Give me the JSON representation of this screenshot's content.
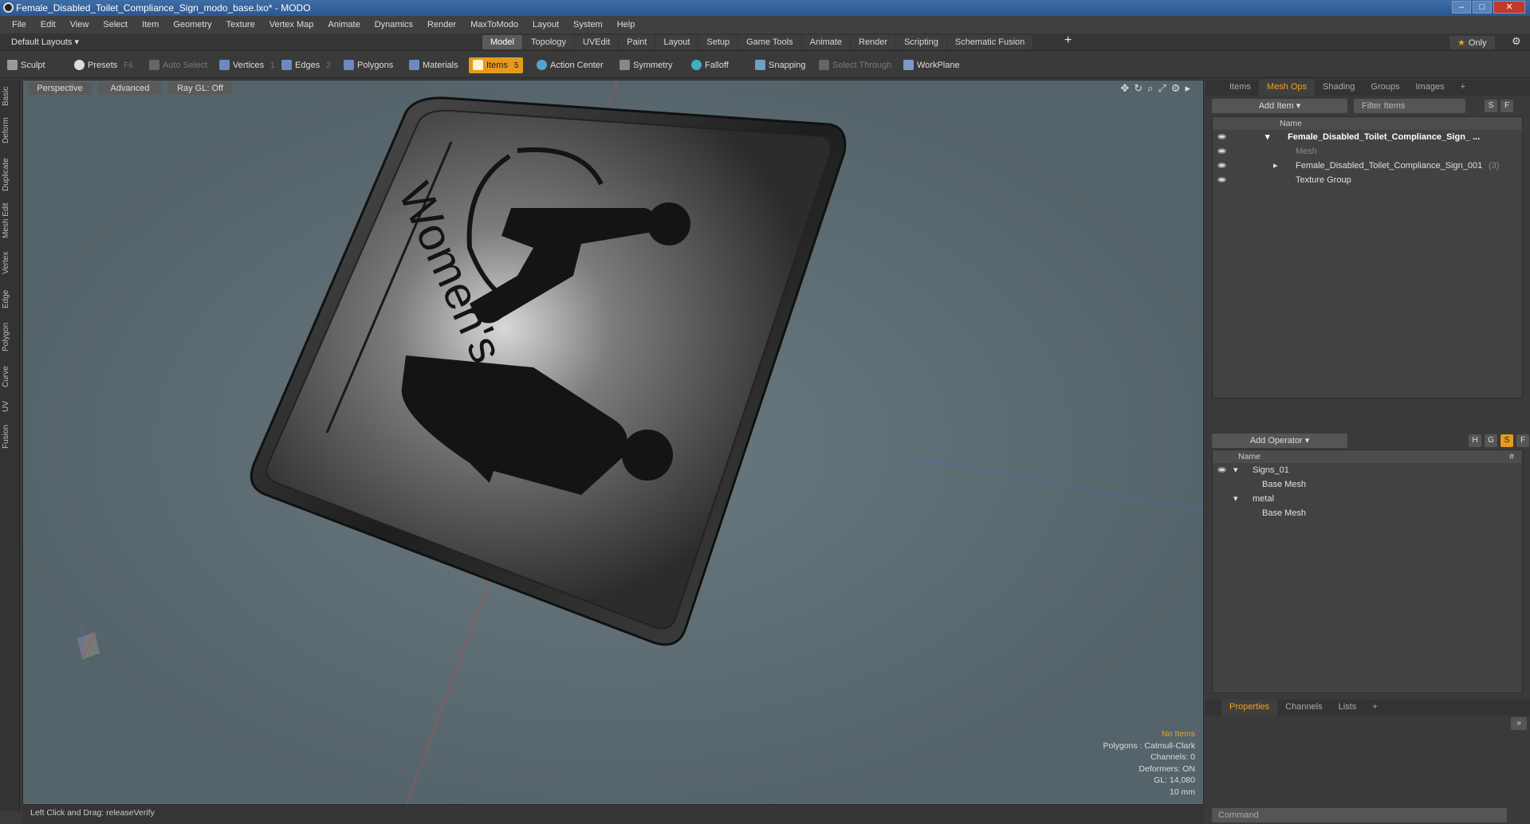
{
  "window": {
    "title": "Female_Disabled_Toilet_Compliance_Sign_modo_base.lxo* - MODO"
  },
  "menu": [
    "File",
    "Edit",
    "View",
    "Select",
    "Item",
    "Geometry",
    "Texture",
    "Vertex Map",
    "Animate",
    "Dynamics",
    "Render",
    "MaxToModo",
    "Layout",
    "System",
    "Help"
  ],
  "layouts_label": "Default Layouts",
  "tabs": [
    "Model",
    "Topology",
    "UVEdit",
    "Paint",
    "Layout",
    "Setup",
    "Game Tools",
    "Animate",
    "Render",
    "Scripting",
    "Schematic Fusion"
  ],
  "only_label": "Only",
  "toolbar": {
    "sculpt": "Sculpt",
    "presets": "Presets",
    "presets_key": "F6",
    "auto_select": "Auto Select",
    "vertices": "Vertices",
    "vertices_n": "1",
    "edges": "Edges",
    "edges_n": "2",
    "polygons": "Polygons",
    "materials": "Materials",
    "items": "Items",
    "items_n": "5",
    "action_center": "Action Center",
    "symmetry": "Symmetry",
    "falloff": "Falloff",
    "snapping": "Snapping",
    "select_through": "Select Through",
    "workplane": "WorkPlane"
  },
  "left_tabs": [
    "Basic",
    "Deform",
    "Duplicate",
    "Mesh Edit",
    "Vertex",
    "Edge",
    "Polygon",
    "Curve",
    "UV",
    "Fusion"
  ],
  "viewport": {
    "view": "Perspective",
    "shading": "Advanced",
    "raygl": "Ray GL: Off",
    "sign_text": "Women's",
    "stats": {
      "no_items": "No Items",
      "polygons": "Polygons : Catmull-Clark",
      "channels": "Channels: 0",
      "deformers": "Deformers: ON",
      "gl": "GL: 14,080",
      "size": "10 mm"
    }
  },
  "status": {
    "text": "Left Click and Drag:   releaseVerify"
  },
  "items_panel": {
    "tabs": [
      "Items",
      "Mesh Ops",
      "Shading",
      "Groups",
      "Images"
    ],
    "add_item": "Add Item",
    "filter": "Filter Items",
    "col_name": "Name",
    "rows": [
      {
        "label": "Female_Disabled_Toilet_Compliance_Sign_ ..."
      },
      {
        "label": "Mesh"
      },
      {
        "label": "Female_Disabled_Toilet_Compliance_Sign_001",
        "count": "(3)"
      },
      {
        "label": "Texture Group"
      }
    ]
  },
  "ops_panel": {
    "add_operator": "Add Operator",
    "col_name": "Name",
    "col_hash": "#",
    "rows": [
      {
        "label": "Signs_01"
      },
      {
        "label": "Base Mesh"
      },
      {
        "label": "metal"
      },
      {
        "label": "Base Mesh"
      }
    ]
  },
  "bottom_tabs": [
    "Properties",
    "Channels",
    "Lists"
  ],
  "command_placeholder": "Command",
  "accent_color": "#e39a1f"
}
